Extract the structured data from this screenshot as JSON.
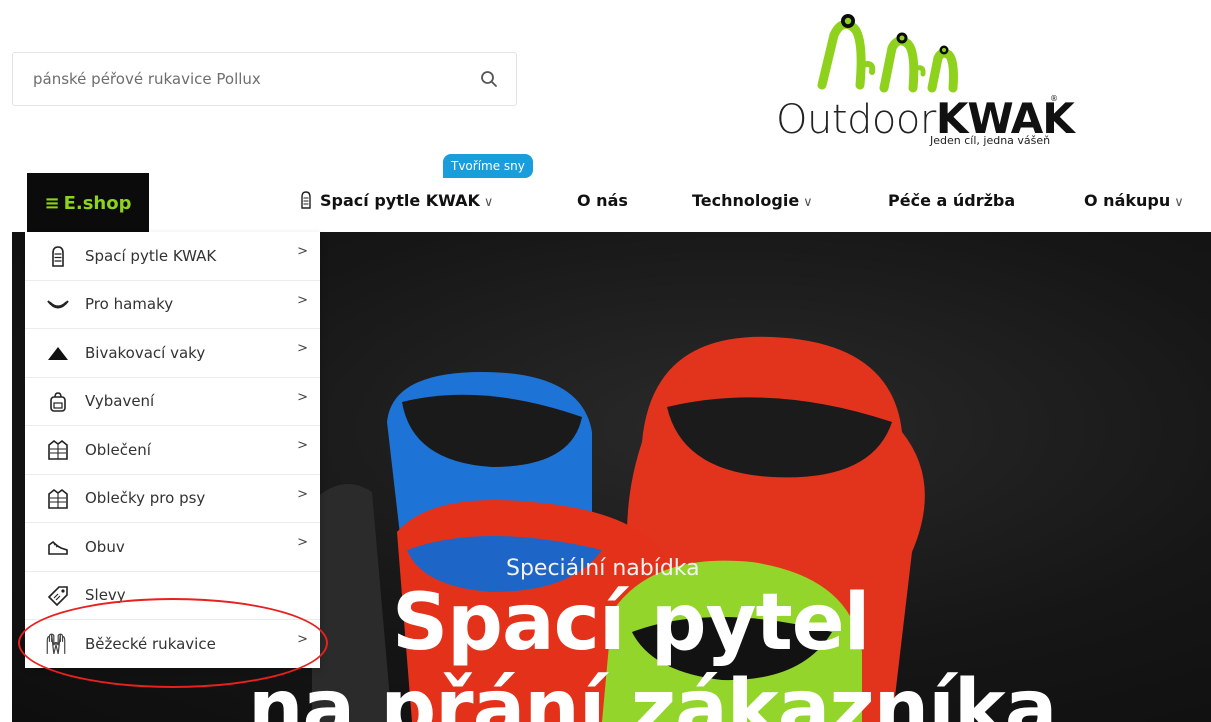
{
  "search": {
    "placeholder": "pánské péřové rukavice Pollux",
    "icon": "search-icon"
  },
  "logo": {
    "word1": "Outdoor",
    "word2": "KWAK",
    "tagline": "Jeden cíl, jedna vášeň",
    "reg": "®",
    "brand_green": "#8ed21d"
  },
  "nav": {
    "eshop": {
      "icon": "hamburger-icon",
      "label": "E.shop"
    },
    "badge": "Tvoříme sny",
    "items": [
      {
        "label": "Spací pytle KWAK",
        "chevron": "∨",
        "icon": "sleeping-bag-icon"
      },
      {
        "label": "O nás"
      },
      {
        "label": "Technologie",
        "chevron": "∨"
      },
      {
        "label": "Péče a údržba"
      },
      {
        "label": "O nákupu",
        "chevron": "∨"
      }
    ]
  },
  "menu": {
    "items": [
      {
        "label": "Spací pytle KWAK",
        "icon": "sleeping-bag-icon",
        "arrow": ">"
      },
      {
        "label": "Pro hamaky",
        "icon": "hammock-icon",
        "arrow": ">"
      },
      {
        "label": "Bivakovací vaky",
        "icon": "tent-icon",
        "arrow": ">"
      },
      {
        "label": "Vybavení",
        "icon": "backpack-icon",
        "arrow": ">"
      },
      {
        "label": "Oblečení",
        "icon": "jacket-icon",
        "arrow": ">"
      },
      {
        "label": "Oblečky pro psy",
        "icon": "dog-jacket-icon",
        "arrow": ">"
      },
      {
        "label": "Obuv",
        "icon": "shoe-icon",
        "arrow": ">"
      },
      {
        "label": "Slevy",
        "icon": "price-tag-icon",
        "arrow": ""
      },
      {
        "label": "Běžecké rukavice",
        "icon": "gloves-icon",
        "arrow": ">"
      }
    ]
  },
  "hero": {
    "subtitle": "Speciální nabídka",
    "title_line1": "Spací pytel",
    "title_line2": "na přání zákazníka"
  },
  "annotation": {
    "color": "#e8201e"
  }
}
